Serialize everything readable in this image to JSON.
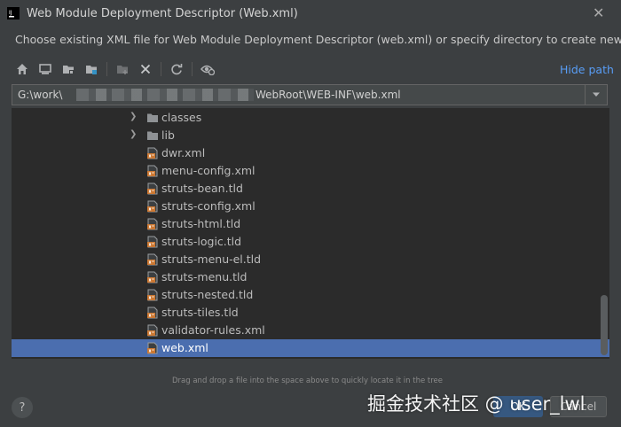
{
  "window": {
    "title": "Web Module Deployment Descriptor (Web.xml)",
    "close_glyph": "✕"
  },
  "description": "Choose existing XML file for Web Module Deployment Descriptor (web.xml) or specify directory to create new file.",
  "toolbar": {
    "icons": [
      "home-icon",
      "desktop-icon",
      "project-folder-icon",
      "module-folder-icon",
      "new-folder-icon",
      "delete-icon",
      "refresh-icon",
      "show-hidden-icon"
    ],
    "hide_path_label": "Hide path"
  },
  "path": {
    "prefix": "G:\\work\\",
    "suffix": "WebRoot\\WEB-INF\\web.xml"
  },
  "tree": {
    "items": [
      {
        "label": "classes",
        "type": "folder",
        "expandable": true
      },
      {
        "label": "lib",
        "type": "folder",
        "expandable": true
      },
      {
        "label": "dwr.xml",
        "type": "xml-file"
      },
      {
        "label": "menu-config.xml",
        "type": "xml-file"
      },
      {
        "label": "struts-bean.tld",
        "type": "xml-file"
      },
      {
        "label": "struts-config.xml",
        "type": "xml-file"
      },
      {
        "label": "struts-html.tld",
        "type": "xml-file"
      },
      {
        "label": "struts-logic.tld",
        "type": "xml-file"
      },
      {
        "label": "struts-menu-el.tld",
        "type": "xml-file"
      },
      {
        "label": "struts-menu.tld",
        "type": "xml-file"
      },
      {
        "label": "struts-nested.tld",
        "type": "xml-file"
      },
      {
        "label": "struts-tiles.tld",
        "type": "xml-file"
      },
      {
        "label": "validator-rules.xml",
        "type": "xml-file"
      },
      {
        "label": "web.xml",
        "type": "xml-file",
        "selected": true
      }
    ]
  },
  "hint": "Drag and drop a file into the space above to quickly locate it in the tree",
  "buttons": {
    "help": "?",
    "ok": "OK",
    "cancel": "Cancel"
  },
  "watermark": "掘金技术社区 @ user_lwl",
  "colors": {
    "background": "#3c3f41",
    "tree_background": "#2b2b2b",
    "selection": "#4b6eaf",
    "link": "#589df6",
    "xml_icon": "#cc7832"
  }
}
